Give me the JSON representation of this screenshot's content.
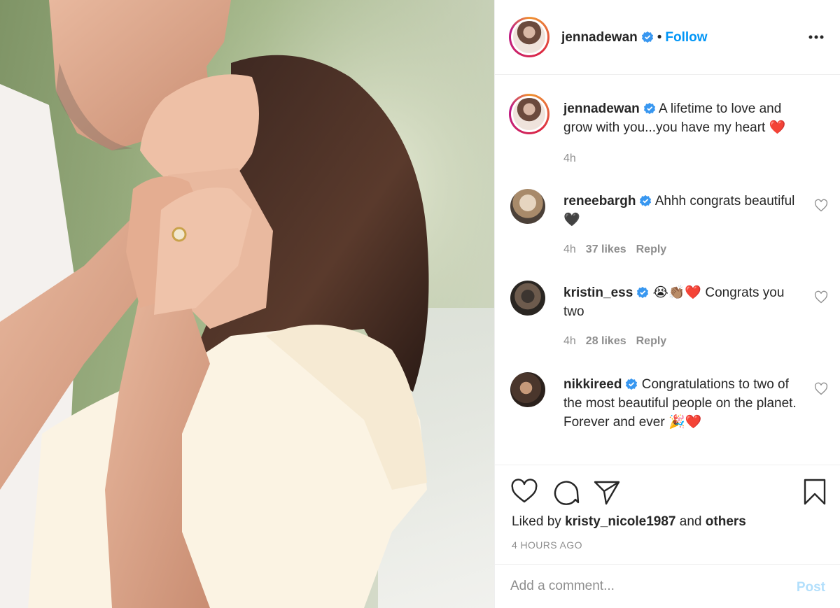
{
  "post": {
    "author": "jennadewan",
    "follow_label": "Follow",
    "separator": "•",
    "more_icon": "ellipsis-icon"
  },
  "caption": {
    "username": "jennadewan",
    "text": "A lifetime to love and grow with you...you have my heart",
    "emoji": "❤️",
    "time": "4h"
  },
  "comments": [
    {
      "username": "reneebargh",
      "text": "Ahhh congrats beautiful",
      "emoji": "🖤",
      "time": "4h",
      "likes": "37 likes",
      "reply": "Reply"
    },
    {
      "username": "kristin_ess",
      "text_before": "😭👏🏽❤️",
      "text": "Congrats you two",
      "time": "4h",
      "likes": "28 likes",
      "reply": "Reply"
    },
    {
      "username": "nikkireed",
      "text": "Congratulations to two of the most beautiful people on the planet. Forever and ever",
      "emoji": "🎉❤️"
    }
  ],
  "actions": {
    "liked_by_prefix": "Liked by",
    "liked_by_user": "kristy_nicole1987",
    "liked_by_and": "and",
    "liked_by_others": "others",
    "timestamp": "4 HOURS AGO"
  },
  "comment_box": {
    "placeholder": "Add a comment...",
    "post_label": "Post"
  },
  "colors": {
    "link": "#0095f6",
    "post_disabled": "#b2dffc",
    "muted": "#8e8e8e",
    "text": "#262626"
  }
}
